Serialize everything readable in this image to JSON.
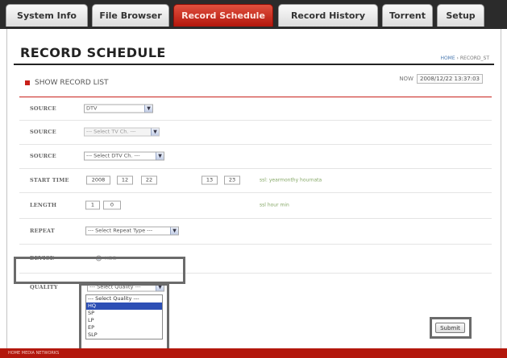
{
  "tabs": [
    {
      "label": "System Info",
      "active": false
    },
    {
      "label": "File Browser",
      "active": false
    },
    {
      "label": "Record Schedule",
      "active": true
    },
    {
      "label": "Record History",
      "active": false
    },
    {
      "label": "Torrent",
      "active": false
    },
    {
      "label": "Setup",
      "active": false
    }
  ],
  "page": {
    "title": "RECORD SCHEDULE",
    "breadcrumb_home": "HOME",
    "breadcrumb_rest": " › RECORD_ST",
    "show_list": "SHOW RECORD LIST",
    "now_label": "NOW",
    "now_value": "2008/12/22 13:37:03"
  },
  "form": {
    "source1_label": "SOURCE",
    "source1_value": "DTV",
    "source2_label": "SOURCE",
    "source2_value": "--- Select TV Ch. ---",
    "source3_label": "SOURCE",
    "source3_value": "--- Select DTV Ch. ---",
    "start_label": "START TIME",
    "start_year": "2008",
    "start_month": "12",
    "start_day": "22",
    "start_hour": "13",
    "start_min": "23",
    "start_hint": "ssl: yearmonthy hournata",
    "length_label": "LENGTH",
    "length_hour": "1",
    "length_min": "0",
    "length_hint": "ssl hour min",
    "repeat_label": "REPEAT",
    "repeat_value": "--- Select Repeat Type ---",
    "device_label": "DEVICE",
    "device_value": "HDD",
    "quality_label": "QUALITY",
    "quality_value": "--- Select Quality ---"
  },
  "quality_options": [
    "--- Select Quality ---",
    "HQ",
    "SP",
    "LP",
    "EP",
    "SLP"
  ],
  "quality_highlighted": "HQ",
  "submit_label": "Submit",
  "footer_text": "HOME MEDIA NETWORKS",
  "colors": {
    "accent": "#c8201a",
    "tab_active": "#b3170c",
    "highlight": "#6b6b6b"
  }
}
